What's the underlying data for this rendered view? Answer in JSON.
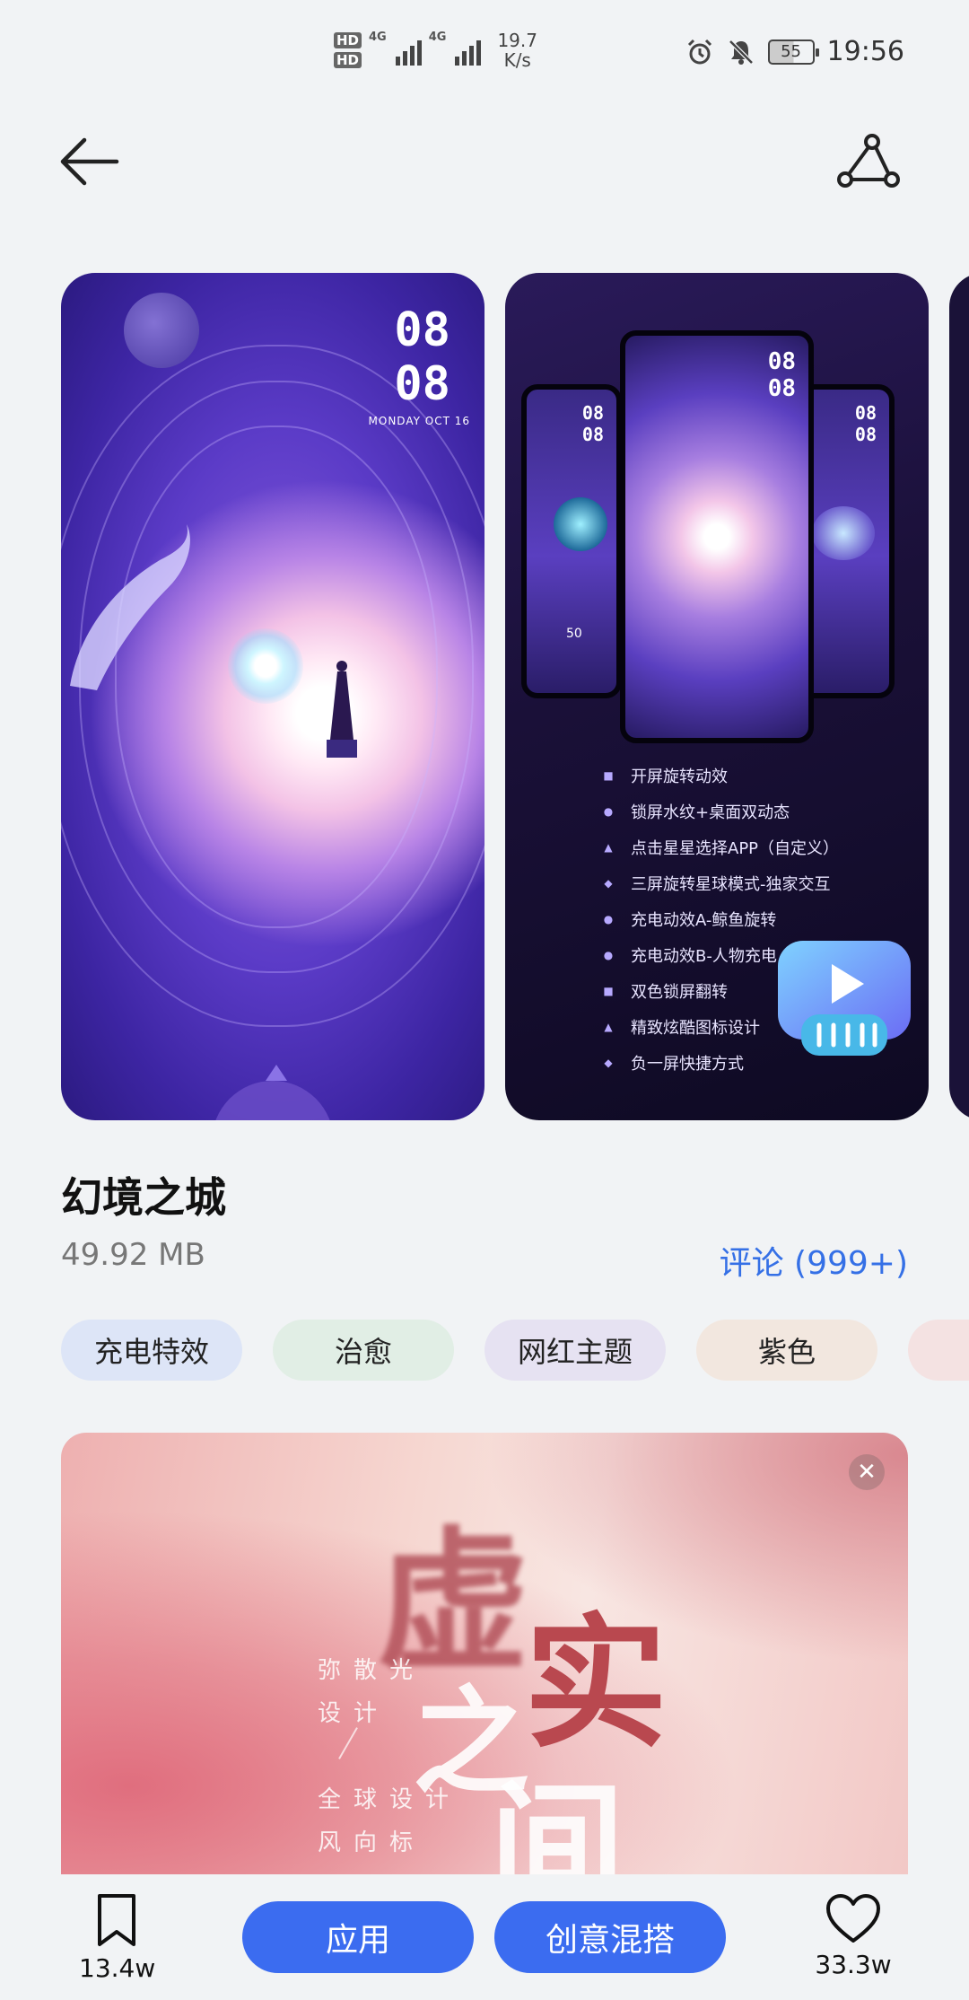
{
  "status_bar": {
    "hd1": "HD",
    "hd2": "HD",
    "net1": "4G",
    "net2": "4G",
    "speed_value": "19.7",
    "speed_unit": "K/s",
    "battery": "55",
    "time": "19:56",
    "icons": [
      "alarm-icon",
      "mute-icon",
      "battery-icon"
    ]
  },
  "nav": {
    "icons": [
      "back-arrow-icon",
      "share-icon"
    ]
  },
  "preview1": {
    "hour": "08",
    "minute": "08",
    "date": "MONDAY OCT 16"
  },
  "preview2": {
    "phone_left": {
      "hour": "08",
      "minute": "08",
      "battery": "50"
    },
    "phone_center": {
      "hour": "08",
      "minute": "08"
    },
    "phone_right": {
      "hour": "08",
      "minute": "08"
    },
    "features": [
      {
        "bullet": "■",
        "text": "开屏旋转动效"
      },
      {
        "bullet": "●",
        "text": "锁屏水纹+桌面双动态"
      },
      {
        "bullet": "▲",
        "text": "点击星星选择APP（自定义）"
      },
      {
        "bullet": "◆",
        "text": "三屏旋转星球模式-独家交互"
      },
      {
        "bullet": "●",
        "text": "充电动效A-鲸鱼旋转"
      },
      {
        "bullet": "●",
        "text": "充电动效B-人物充电"
      },
      {
        "bullet": "■",
        "text": "双色锁屏翻转"
      },
      {
        "bullet": "▲",
        "text": "精致炫酷图标设计"
      },
      {
        "bullet": "◆",
        "text": "负一屏快捷方式"
      }
    ]
  },
  "theme": {
    "title": "幻境之城",
    "size": "49.92 MB",
    "reviews": "评论 (999+)"
  },
  "tags": [
    {
      "label": "充电特效",
      "color": "#dde5f7"
    },
    {
      "label": "治愈",
      "color": "#e1eee5"
    },
    {
      "label": "网红主题",
      "color": "#e6e2f2"
    },
    {
      "label": "紫色",
      "color": "#f2e7df"
    },
    {
      "label": "",
      "color": "#f4e2e2"
    }
  ],
  "banner": {
    "char1": "虚",
    "char2": "实",
    "char3": "之",
    "char4": "间",
    "line1": "弥散光",
    "line2": "设计",
    "line3": "全球设计",
    "line4": "风向标",
    "close": "✕"
  },
  "bottom_bar": {
    "bookmark_count": "13.4w",
    "apply_label": "应用",
    "mix_label": "创意混搭",
    "like_count": "33.3w"
  },
  "colors": {
    "accent": "#3b6cf0",
    "link": "#3570e6",
    "background": "#f1f3f5"
  }
}
